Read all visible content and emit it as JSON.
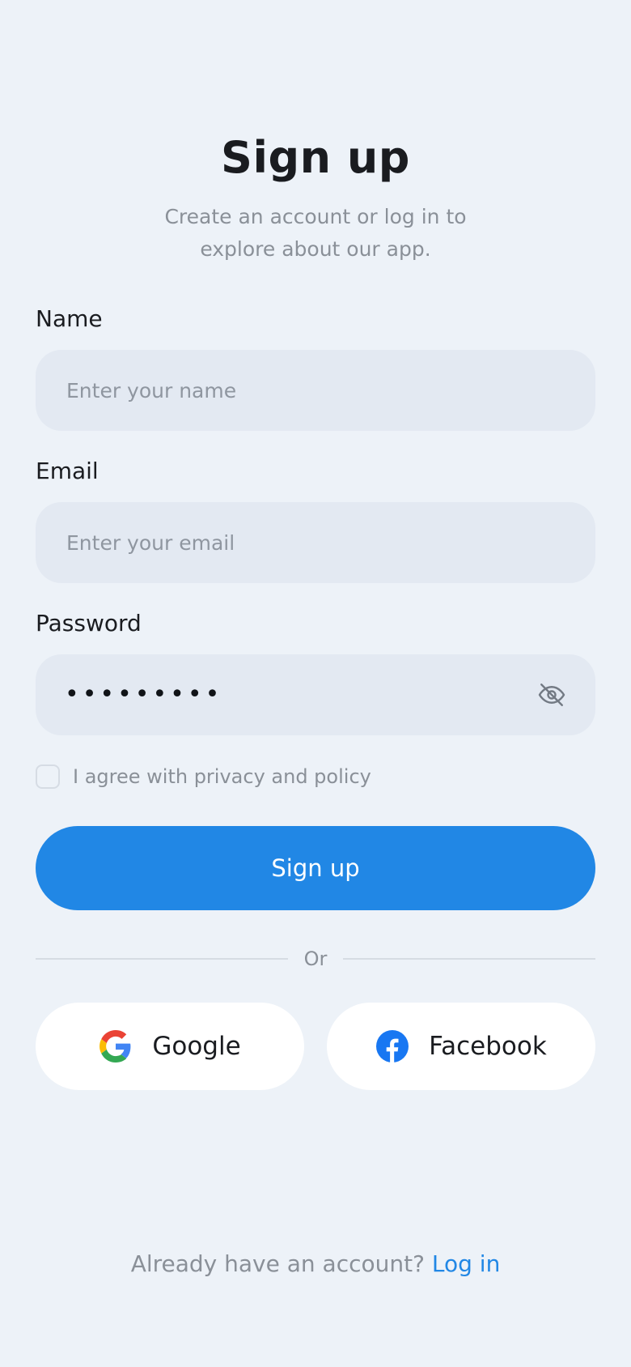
{
  "header": {
    "title": "Sign up",
    "subtitle_line1": "Create an account or log in to",
    "subtitle_line2": "explore about our app."
  },
  "form": {
    "name_label": "Name",
    "name_placeholder": "Enter your name",
    "email_label": "Email",
    "email_placeholder": "Enter your email",
    "password_label": "Password",
    "password_mask": "•••••••••",
    "password_toggle_icon": "eye-off-icon",
    "agree_text": "I agree with privacy and policy",
    "agree_checked": false
  },
  "actions": {
    "signup_label": "Sign up",
    "divider_text": "Or",
    "google_label": "Google",
    "facebook_label": "Facebook"
  },
  "footer": {
    "prompt": "Already have an account? ",
    "link_label": "Log in"
  },
  "colors": {
    "background": "#EDF2F8",
    "field": "#E3E9F2",
    "primary": "#2187E5",
    "muted_text": "#8A9098",
    "facebook": "#1877F2"
  }
}
